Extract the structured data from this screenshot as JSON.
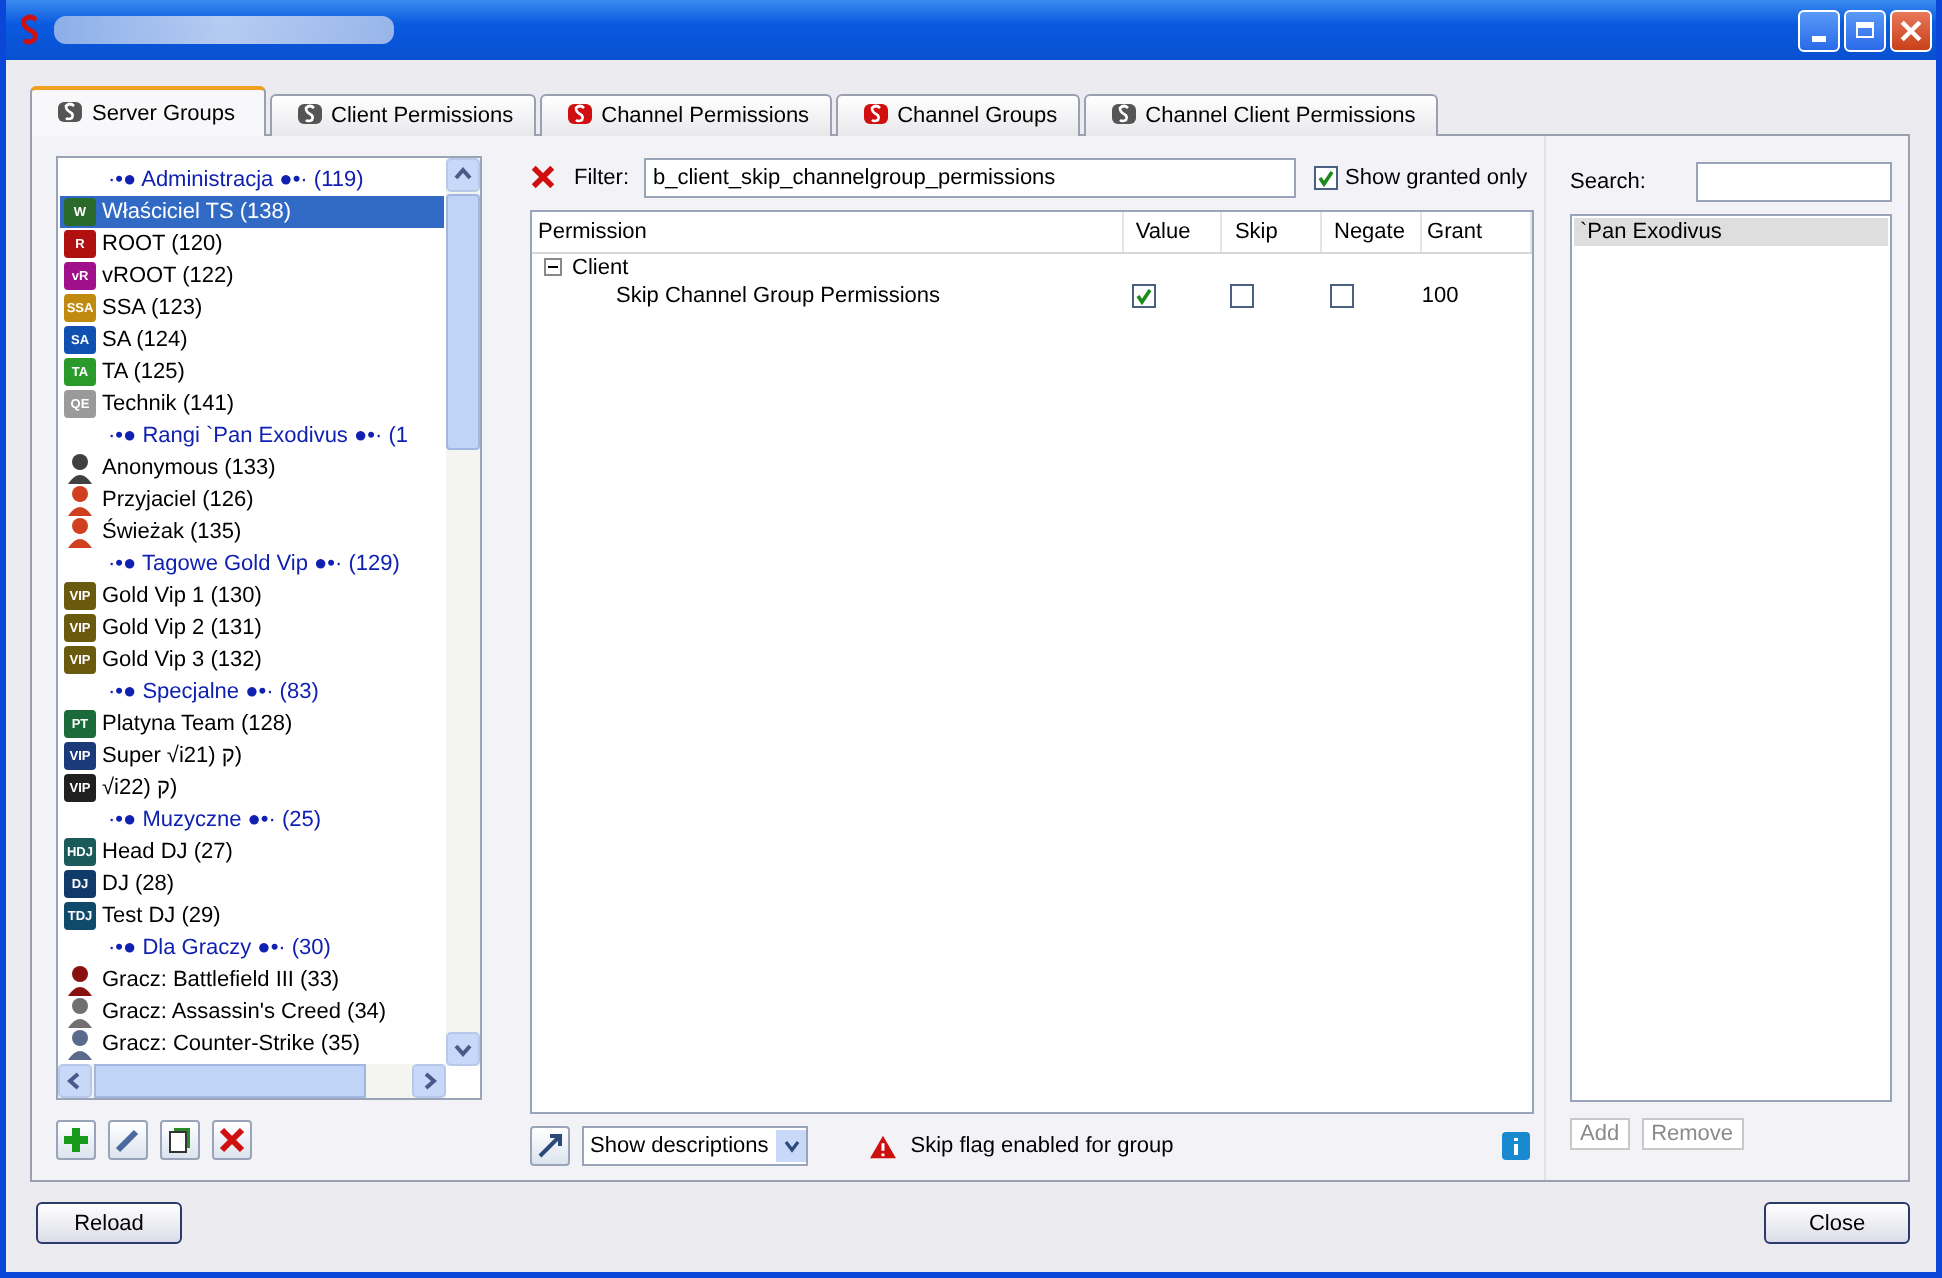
{
  "tabs": [
    {
      "label": "Server Groups",
      "selected": true
    },
    {
      "label": "Client Permissions",
      "selected": false
    },
    {
      "label": "Channel Permissions",
      "selected": false
    },
    {
      "label": "Channel Groups",
      "selected": false
    },
    {
      "label": "Channel Client Permissions",
      "selected": false
    }
  ],
  "groups": [
    {
      "kind": "header",
      "label": "·•● Administracja ●•· (119)",
      "selected": false
    },
    {
      "kind": "group",
      "label": "Właściciel TS (138)",
      "badge": "W",
      "color": "#2a6a2a",
      "selected": true
    },
    {
      "kind": "group",
      "label": "ROOT (120)",
      "badge": "R",
      "color": "#b01010",
      "selected": false
    },
    {
      "kind": "group",
      "label": "vROOT (122)",
      "badge": "vR",
      "color": "#a0108a",
      "selected": false
    },
    {
      "kind": "group",
      "label": "SSA (123)",
      "badge": "SSA",
      "color": "#c08a10",
      "selected": false
    },
    {
      "kind": "group",
      "label": "SA (124)",
      "badge": "SA",
      "color": "#1050b0",
      "selected": false
    },
    {
      "kind": "group",
      "label": "TA (125)",
      "badge": "TA",
      "color": "#2a9a2a",
      "selected": false
    },
    {
      "kind": "group",
      "label": "Technik (141)",
      "badge": "QE",
      "color": "#9a9a9a",
      "selected": false
    },
    {
      "kind": "header",
      "label": "·•● Rangi `Pan Exodivus ●•·  (1",
      "selected": false
    },
    {
      "kind": "figure",
      "label": "Anonymous (133)",
      "color": "#404040",
      "selected": false
    },
    {
      "kind": "figure",
      "label": "Przyjaciel (126)",
      "color": "#d04020",
      "selected": false
    },
    {
      "kind": "figure",
      "label": "Świeżak (135)",
      "color": "#d04020",
      "selected": false
    },
    {
      "kind": "header",
      "label": "·•● Tagowe Gold Vip ●•· (129)",
      "selected": false
    },
    {
      "kind": "group",
      "label": "Gold Vip 1 (130)",
      "badge": "VIP",
      "color": "#6a5a10",
      "selected": false
    },
    {
      "kind": "group",
      "label": "Gold Vip 2 (131)",
      "badge": "VIP",
      "color": "#6a5a10",
      "selected": false
    },
    {
      "kind": "group",
      "label": "Gold Vip 3 (132)",
      "badge": "VIP",
      "color": "#6a5a10",
      "selected": false
    },
    {
      "kind": "header",
      "label": "·•● Specjalne ●•· (83)",
      "selected": false
    },
    {
      "kind": "group",
      "label": "Platyna Team (128)",
      "badge": "PT",
      "color": "#1a6a3a",
      "selected": false
    },
    {
      "kind": "group",
      "label": "Super √i21) ק)",
      "badge": "VIP",
      "color": "#1a3a7a",
      "selected": false
    },
    {
      "kind": "group",
      "label": "√i22) ק)",
      "badge": "VIP",
      "color": "#202020",
      "selected": false
    },
    {
      "kind": "header",
      "label": "·•● Muzyczne ●•· (25)",
      "selected": false
    },
    {
      "kind": "group",
      "label": "Head DJ (27)",
      "badge": "HDJ",
      "color": "#1a5a5a",
      "selected": false
    },
    {
      "kind": "group",
      "label": "DJ (28)",
      "badge": "DJ",
      "color": "#103a6a",
      "selected": false
    },
    {
      "kind": "group",
      "label": "Test DJ (29)",
      "badge": "TDJ",
      "color": "#104a6a",
      "selected": false
    },
    {
      "kind": "header",
      "label": "·•● Dla Graczy ●•· (30)",
      "selected": false
    },
    {
      "kind": "figure",
      "label": "Gracz: Battlefield III (33)",
      "color": "#8a1010",
      "selected": false
    },
    {
      "kind": "figure",
      "label": "Gracz: Assassin's Creed (34)",
      "color": "#707070",
      "selected": false
    },
    {
      "kind": "figure",
      "label": "Gracz: Counter-Strike (35)",
      "color": "#5a6a8a",
      "selected": false
    }
  ],
  "filter": {
    "label": "Filter:",
    "value": "b_client_skip_channelgroup_permissions",
    "show_granted_only": {
      "label": "Show granted only",
      "checked": true
    }
  },
  "table": {
    "columns": [
      "Permission",
      "Value",
      "Skip",
      "Negate",
      "Grant"
    ],
    "tree": [
      {
        "label": "Client",
        "expanded": true,
        "children": [
          {
            "label": "Skip Channel Group Permissions",
            "value": true,
            "skip": false,
            "negate": false,
            "grant": "100"
          }
        ]
      }
    ]
  },
  "bottom": {
    "dropdown": "Show descriptions",
    "warning": "Skip flag enabled for group"
  },
  "search": {
    "label": "Search:"
  },
  "members": [
    {
      "label": "`Pan Exodivus",
      "selected": true
    }
  ],
  "member_buttons": [
    {
      "label": "Add",
      "disabled": true
    },
    {
      "label": "Remove",
      "disabled": true
    }
  ],
  "buttons": [
    {
      "label": "Reload"
    },
    {
      "label": "Close"
    }
  ]
}
